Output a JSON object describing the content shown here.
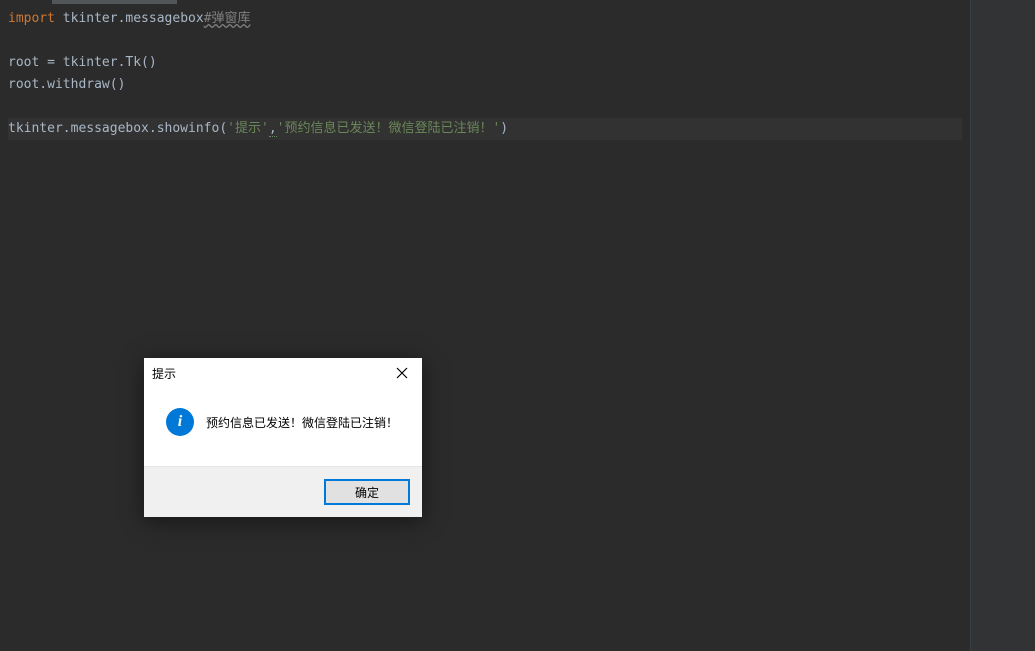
{
  "code": {
    "line1": {
      "import": "import",
      "module": " tkinter.messagebox",
      "comment": "#弹窗库"
    },
    "line3": "root = tkinter.Tk()",
    "line4": "root.withdraw()",
    "line6": {
      "call": "tkinter.messagebox.showinfo(",
      "arg1": "'提示'",
      "sep": ",",
      "arg2": "'预约信息已发送！微信登陆已注销！'",
      "close": ")"
    }
  },
  "dialog": {
    "title": "提示",
    "message": "预约信息已发送！微信登陆已注销！",
    "ok_label": "确定",
    "info_letter": "i"
  }
}
